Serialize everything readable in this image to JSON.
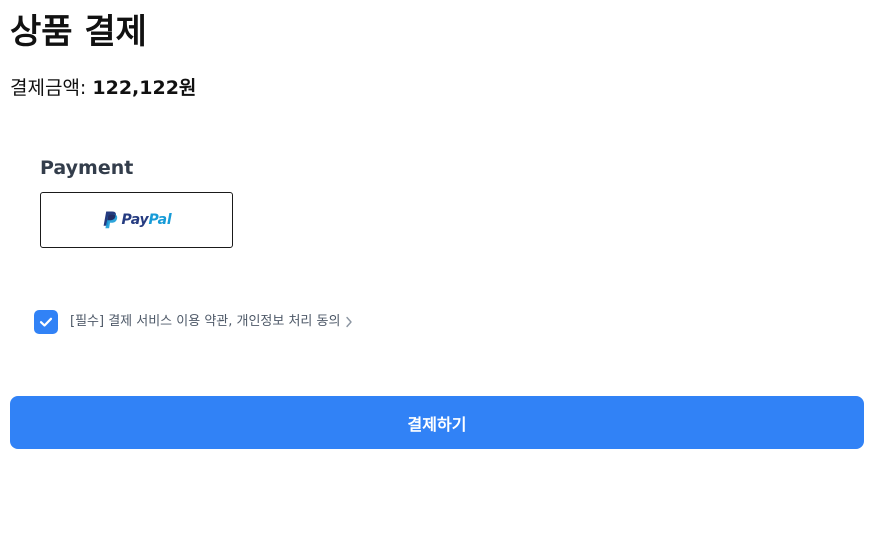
{
  "page": {
    "title": "상품 결제"
  },
  "amount": {
    "label": "결제금액: ",
    "value": "122,122원"
  },
  "payment": {
    "heading": "Payment",
    "methods": [
      {
        "name_pay": "Pay",
        "name_pal": "Pal",
        "icon": "paypal-logo",
        "brand_colors": [
          "#253b80",
          "#179bd7"
        ]
      }
    ]
  },
  "agreement": {
    "checked": true,
    "text": "[필수] 결제 서비스 이용 약관, 개인정보 처리 동의",
    "icon": "chevron-right-icon"
  },
  "submit": {
    "label": "결제하기"
  },
  "colors": {
    "accent": "#3182f6",
    "heading_text": "#333d4b",
    "secondary_text": "#4e5968"
  }
}
